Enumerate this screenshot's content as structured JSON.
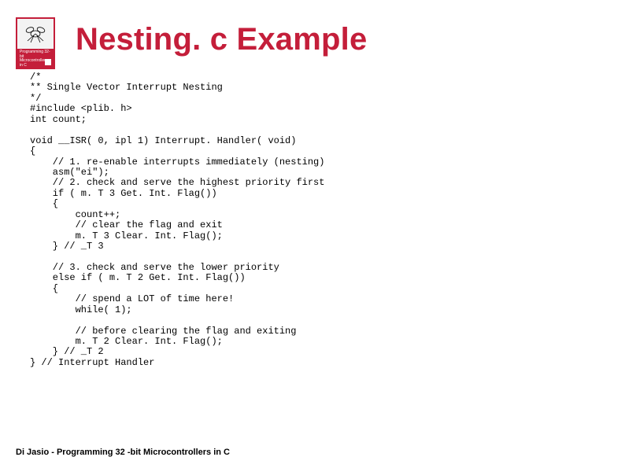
{
  "slide": {
    "title": "Nesting. c Example",
    "thumb_caption": "Programming 32-bit Microcontrollers in C",
    "code": "/*\n** Single Vector Interrupt Nesting\n*/\n#include <plib. h>\nint count;\n\nvoid __ISR( 0, ipl 1) Interrupt. Handler( void)\n{\n    // 1. re-enable interrupts immediately (nesting)\n    asm(\"ei\");\n    // 2. check and serve the highest priority first\n    if ( m. T 3 Get. Int. Flag())\n    {\n        count++;\n        // clear the flag and exit\n        m. T 3 Clear. Int. Flag();\n    } // _T 3\n\n    // 3. check and serve the lower priority\n    else if ( m. T 2 Get. Int. Flag())\n    {\n        // spend a LOT of time here!\n        while( 1);\n\n        // before clearing the flag and exiting\n        m. T 2 Clear. Int. Flag();\n    } // _T 2\n} // Interrupt Handler",
    "footer": "Di Jasio - Programming 32 -bit Microcontrollers in C"
  }
}
